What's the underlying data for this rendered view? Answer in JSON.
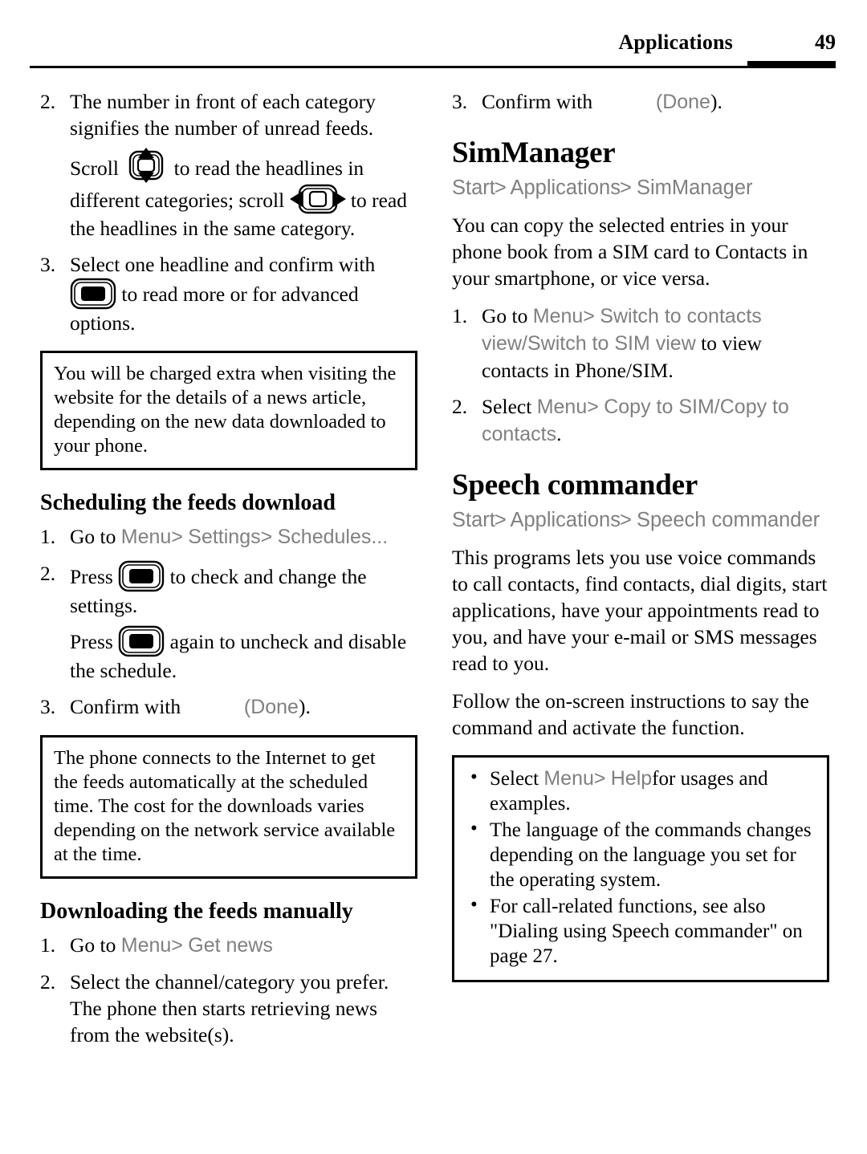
{
  "header": {
    "title": "Applications",
    "page_number": "49"
  },
  "left_column": {
    "step2": {
      "num": "2.",
      "line1": "The number in front of each category signifies the number of unread feeds.",
      "scroll_pre": "Scroll",
      "scroll_mid": "to read the headlines in different categories; scroll",
      "scroll_post": "to read the headlines in the same category."
    },
    "step3": {
      "num": "3.",
      "text_pre": "Select one headline and confirm with",
      "text_post": "to read more or for advanced options."
    },
    "note1": "You will be charged extra when visiting the website for the details of a news article, depending on the new data downloaded to your phone.",
    "heading_scheduling": "Scheduling the feeds download",
    "sched_step1": {
      "num": "1.",
      "pre": "Go to",
      "menu": "Menu",
      "sep": ">",
      "settings": "Settings",
      "schedules": "Schedules..."
    },
    "sched_step2": {
      "num": "2.",
      "press1_pre": "Press",
      "press1_post": "to check and change the settings.",
      "press2_pre": "Press",
      "press2_post": "again to uncheck and disable the schedule."
    },
    "sched_step3": {
      "num": "3.",
      "pre": "Confirm with",
      "done": "(Done",
      "done_close": ")."
    },
    "note2": "The phone connects to the Internet to get the feeds automatically at the scheduled time. The cost for the downloads varies depending on the network service available at the time.",
    "heading_downloading": "Downloading the feeds manually",
    "dl_step1": {
      "num": "1.",
      "pre": "Go to",
      "menu": "Menu",
      "sep": ">",
      "getnews": "Get news"
    },
    "dl_step2": {
      "num": "2.",
      "text": "Select the channel/category you prefer. The phone then starts retrieving news from the website(s)."
    }
  },
  "right_column": {
    "step3": {
      "num": "3.",
      "pre": "Confirm with",
      "done": "(Done",
      "done_close": ")."
    },
    "simmanager": {
      "heading": "SimManager",
      "crumb_start": "Start",
      "crumb_sep": ">",
      "crumb_applications": "Applications",
      "crumb_last": "SimManager",
      "intro": "You can copy the selected entries in your phone book from a SIM card to Contacts in your smartphone, or vice versa.",
      "step1": {
        "num": "1.",
        "pre": "Go to",
        "menu": "Menu",
        "sep": ">",
        "cmd_a": "Switch to contacts view",
        "slash": "/",
        "cmd_b": "Switch to SIM view",
        "post": "to view contacts in Phone/SIM."
      },
      "step2": {
        "num": "2.",
        "pre": "Select",
        "menu": "Menu",
        "sep": ">",
        "cmd_a": "Copy to SIM",
        "slash": "/",
        "cmd_b": "Copy to contacts",
        "period": "."
      }
    },
    "speech": {
      "heading": "Speech commander",
      "crumb_start": "Start",
      "crumb_sep": ">",
      "crumb_applications": "Applications",
      "crumb_last": "Speech commander",
      "para1": "This programs lets you use voice commands to call contacts, find contacts, dial digits, start applications, have your appointments read to you, and have your e-mail or SMS messages read to you.",
      "para2": "Follow the on-screen instructions to say the command and activate the function.",
      "notes": {
        "bullet1_pre": "Select",
        "bullet1_menu": "Menu",
        "bullet1_sep": ">",
        "bullet1_help": "Help",
        "bullet1_post": "for usages and examples.",
        "bullet2": "The language of the commands changes depending on the language you set for the operating system.",
        "bullet3": "For call-related functions, see also \"Dialing using Speech commander\" on page 27."
      }
    }
  },
  "icons": {
    "scroll_vertical": "scroll-up-down-key-icon",
    "scroll_horizontal": "scroll-left-right-key-icon",
    "select_key": "select-key-icon"
  },
  "colors": {
    "text": "#000000",
    "ui_term_gray": "#808080",
    "rule": "#000000"
  }
}
